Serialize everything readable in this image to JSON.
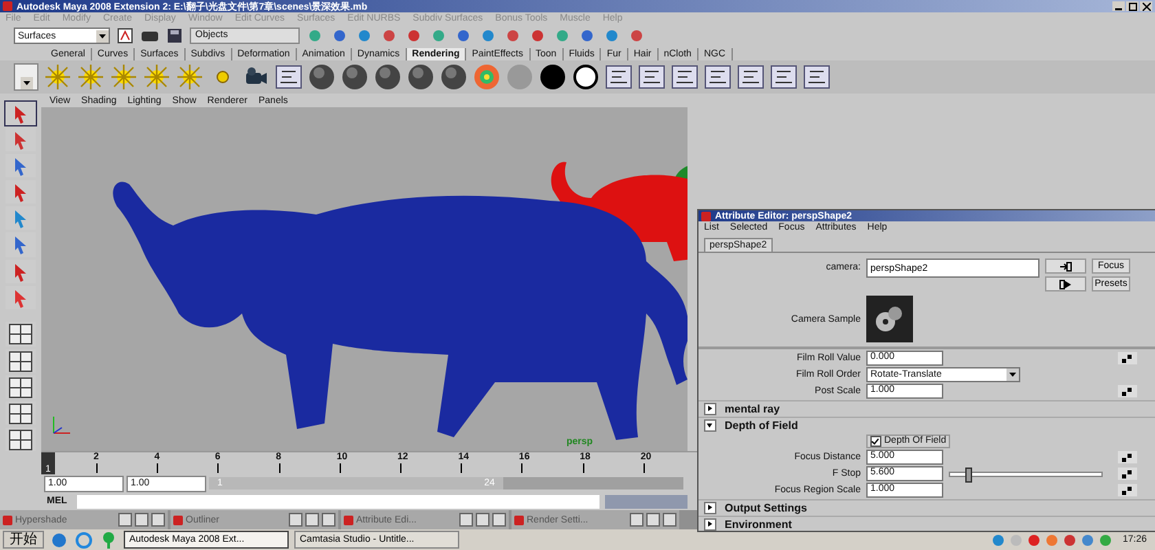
{
  "window": {
    "title": "Autodesk Maya 2008 Extension 2: E:\\翻子\\光盘文件\\第7章\\scenes\\景深效果.mb",
    "menu": [
      "File",
      "Edit",
      "Modify",
      "Create",
      "Display",
      "Window",
      "Edit Curves",
      "Surfaces",
      "Edit NURBS",
      "Subdiv Surfaces",
      "Bonus Tools",
      "Muscle",
      "Help"
    ]
  },
  "status_line": {
    "menu_set": "Surfaces",
    "selection_mode": "Objects"
  },
  "shelf": {
    "tabs": [
      {
        "label": "General",
        "selected": false
      },
      {
        "label": "Curves",
        "selected": false
      },
      {
        "label": "Surfaces",
        "selected": false
      },
      {
        "label": "Subdivs",
        "selected": false
      },
      {
        "label": "Deformation",
        "selected": false
      },
      {
        "label": "Animation",
        "selected": false
      },
      {
        "label": "Dynamics",
        "selected": false
      },
      {
        "label": "Rendering",
        "selected": true
      },
      {
        "label": "PaintEffects",
        "selected": false
      },
      {
        "label": "Toon",
        "selected": false
      },
      {
        "label": "Fluids",
        "selected": false
      },
      {
        "label": "Fur",
        "selected": false
      },
      {
        "label": "Hair",
        "selected": false
      },
      {
        "label": "nCloth",
        "selected": false
      },
      {
        "label": "NGC",
        "selected": false
      }
    ]
  },
  "viewport": {
    "menu": [
      "View",
      "Shading",
      "Lighting",
      "Show",
      "Renderer",
      "Panels"
    ],
    "camera_label": "persp"
  },
  "time_slider": {
    "current_frame": "1",
    "level": 0,
    "ticks": [
      "2",
      "4",
      "6",
      "8",
      "10",
      "12",
      "14",
      "16",
      "18",
      "20"
    ]
  },
  "range_slider": {
    "start": "1.00",
    "field_2": "1.00",
    "range_start": "1",
    "range_end": "24",
    "level": 0.62
  },
  "command_line": {
    "label": "MEL"
  },
  "minimized_windows": [
    {
      "title": "Hypershade"
    },
    {
      "title": "Outliner"
    },
    {
      "title": "Attribute Edi..."
    },
    {
      "title": "Render Setti..."
    }
  ],
  "taskbar": {
    "start": "开始",
    "buttons": [
      {
        "label": "Autodesk Maya 2008 Ext...",
        "selected": true
      },
      {
        "label": "Camtasia Studio - Untitle...",
        "selected": false
      }
    ],
    "clock": "17:26"
  },
  "attribute_editor": {
    "title": "Attribute Editor: perspShape2",
    "menu": [
      "List",
      "Selected",
      "Focus",
      "Attributes",
      "Help"
    ],
    "tab": "perspShape2",
    "camera_label": "camera:",
    "camera_value": "perspShape2",
    "buttons": [
      "Focus",
      "Presets"
    ],
    "sample_label": "Camera Sample",
    "rows": [
      {
        "label": "Film Roll Value",
        "value": "0.000",
        "kind": "field"
      },
      {
        "label": "Film Roll Order",
        "value": "Rotate-Translate",
        "kind": "dropdown"
      },
      {
        "label": "Post Scale",
        "value": "1.000",
        "kind": "field"
      }
    ],
    "sections": [
      {
        "title": "mental ray",
        "expanded": false
      },
      {
        "title": "Depth of Field",
        "expanded": true,
        "checkbox": {
          "label": "Depth Of Field",
          "checked": true
        },
        "rows": [
          {
            "label": "Focus Distance",
            "value": "5.000",
            "kind": "field"
          },
          {
            "label": "F Stop",
            "value": "5.600",
            "kind": "slider",
            "level": 0.1
          },
          {
            "label": "Focus Region Scale",
            "value": "1.000",
            "kind": "field"
          }
        ]
      },
      {
        "title": "Output Settings",
        "expanded": false
      },
      {
        "title": "Environment",
        "expanded": false
      }
    ]
  }
}
